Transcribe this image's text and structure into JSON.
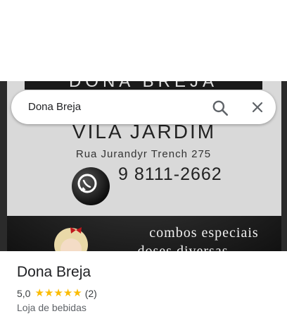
{
  "search": {
    "query": "Dona Breja",
    "search_icon": "search-icon",
    "close_icon": "close-icon"
  },
  "photo": {
    "sign_top": "DONA BREJA",
    "neighborhood": "VILA JARDIM",
    "address": "Rua Jurandyr Trench 275",
    "phone": "9 8111-2662",
    "promo1": "combos especiais",
    "promo2": "doses diversas",
    "whatsapp_icon": "whatsapp-icon"
  },
  "place": {
    "name": "Dona Breja",
    "rating": "5,0",
    "stars": 5,
    "review_count": "(2)",
    "category": "Loja de bebidas"
  },
  "colors": {
    "star": "#fbbc04",
    "photo_bg": "#1d1d1d",
    "sign_bg": "#d9d9d9"
  }
}
